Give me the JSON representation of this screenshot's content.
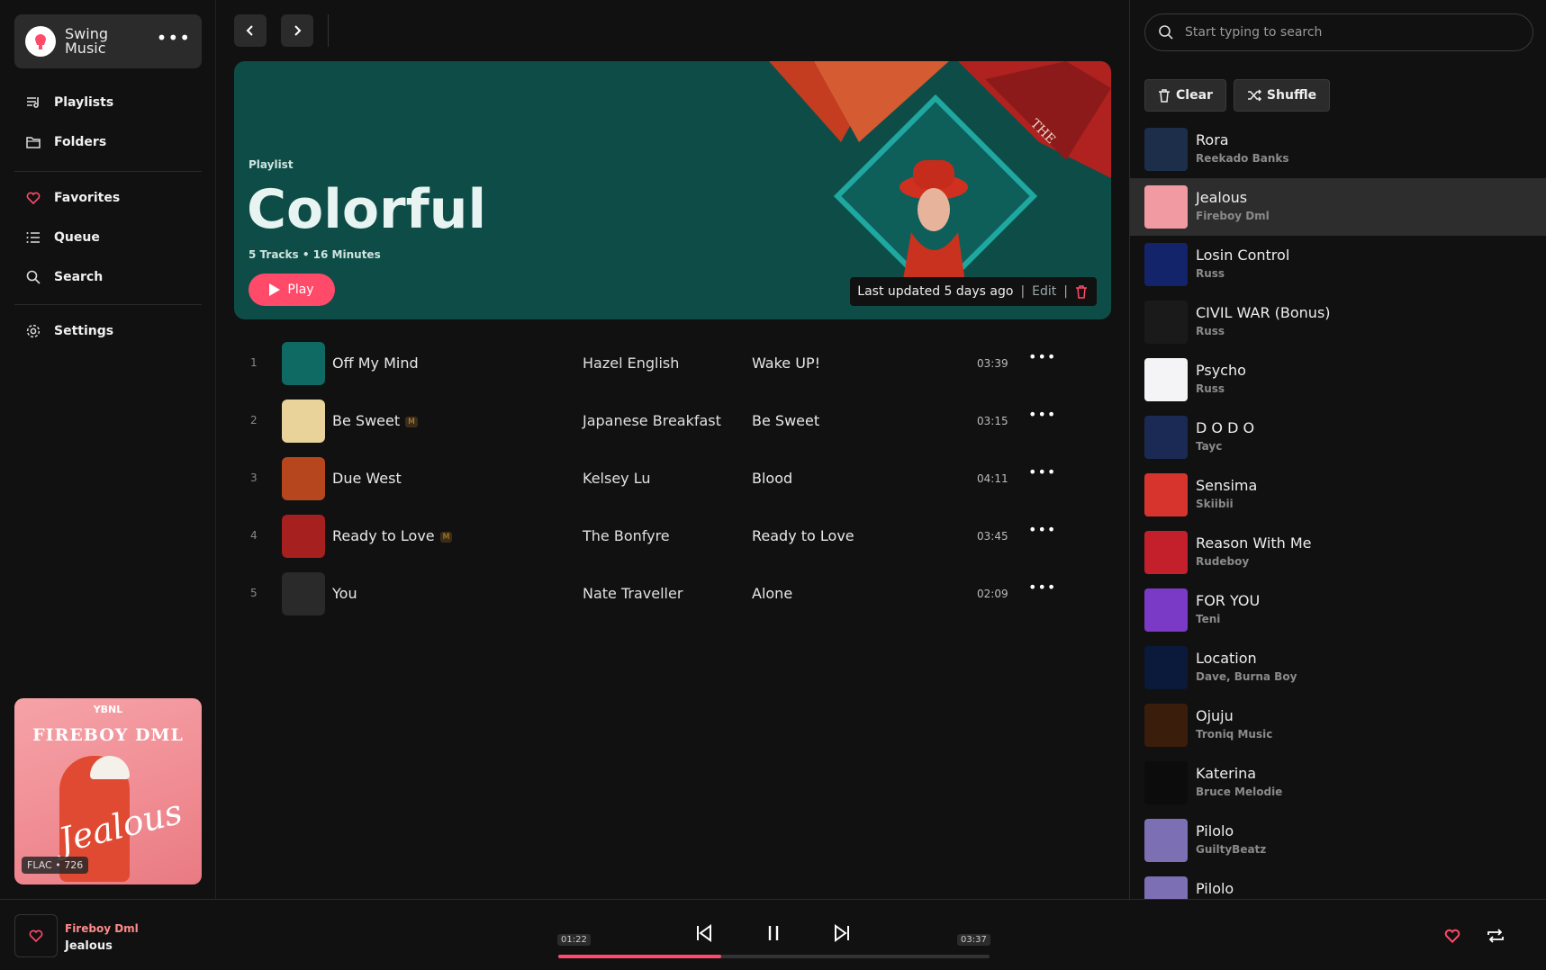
{
  "brand": {
    "name": "Swing Music"
  },
  "nav": {
    "playlists": "Playlists",
    "folders": "Folders",
    "favorites": "Favorites",
    "queue": "Queue",
    "search": "Search",
    "settings": "Settings"
  },
  "now_art": {
    "tag": "YBNL",
    "name": "FIREBOY DML",
    "script": "Jealous",
    "badge": "FLAC • 726"
  },
  "hero": {
    "label": "Playlist",
    "title": "Colorful",
    "meta": "5 Tracks • 16 Minutes",
    "play": "Play",
    "updated": "Last updated 5 days ago",
    "edit": "Edit"
  },
  "tracks": [
    {
      "num": "1",
      "title": "Off My Mind",
      "badge": "",
      "artist": "Hazel English",
      "album": "Wake UP!",
      "duration": "03:39",
      "color": "#0f6a63"
    },
    {
      "num": "2",
      "title": "Be Sweet",
      "badge": "M",
      "artist": "Japanese Breakfast",
      "album": "Be Sweet",
      "duration": "03:15",
      "color": "#e9d39a"
    },
    {
      "num": "3",
      "title": "Due West",
      "badge": "",
      "artist": "Kelsey Lu",
      "album": "Blood",
      "duration": "04:11",
      "color": "#b5461e"
    },
    {
      "num": "4",
      "title": "Ready to Love",
      "badge": "M",
      "artist": "The Bonfyre",
      "album": "Ready to Love",
      "duration": "03:45",
      "color": "#a6201f"
    },
    {
      "num": "5",
      "title": "You",
      "badge": "",
      "artist": "Nate Traveller",
      "album": "Alone",
      "duration": "02:09",
      "color": "#2a2a2a"
    }
  ],
  "search": {
    "placeholder": "Start typing to search"
  },
  "queue_buttons": {
    "clear": "Clear",
    "shuffle": "Shuffle"
  },
  "queue": [
    {
      "title": "Rora",
      "artist": "Reekado Banks",
      "color": "#1c2e4a"
    },
    {
      "title": "Jealous",
      "artist": "Fireboy Dml",
      "color": "#f29aa2"
    },
    {
      "title": "Losin Control",
      "artist": "Russ",
      "color": "#14246a"
    },
    {
      "title": "CIVIL WAR (Bonus)",
      "artist": "Russ",
      "color": "#1a1a1a"
    },
    {
      "title": "Psycho",
      "artist": "Russ",
      "color": "#f4f4f6"
    },
    {
      "title": "D O D O",
      "artist": "Tayc",
      "color": "#1b2a55"
    },
    {
      "title": "Sensima",
      "artist": "Skiibii",
      "color": "#d8342e"
    },
    {
      "title": "Reason With Me",
      "artist": "Rudeboy",
      "color": "#c4202b"
    },
    {
      "title": "FOR YOU",
      "artist": "Teni",
      "color": "#7a3ac6"
    },
    {
      "title": "Location",
      "artist": "Dave, Burna Boy",
      "color": "#0b1a3a"
    },
    {
      "title": "Ojuju",
      "artist": "Troniq Music",
      "color": "#3a1d0a"
    },
    {
      "title": "Katerina",
      "artist": "Bruce Melodie",
      "color": "#0c0c0c"
    },
    {
      "title": "Pilolo",
      "artist": "GuiltyBeatz",
      "color": "#7d6fb4"
    },
    {
      "title": "Pilolo",
      "artist": "",
      "color": "#7d6fb4"
    }
  ],
  "player": {
    "artist": "Fireboy Dml",
    "title": "Jealous",
    "elapsed": "01:22",
    "total": "03:37",
    "progress": 0.378
  },
  "colors": {
    "accent": "#ff4a6a",
    "hero_bg": "#0e4d47"
  },
  "icons": [
    "music-logo-icon",
    "more-icon",
    "playlists-icon",
    "folders-icon",
    "heart-icon",
    "queue-icon",
    "search-icon",
    "settings-icon",
    "chevron-left-icon",
    "chevron-right-icon",
    "play-icon",
    "trash-icon",
    "shuffle-icon",
    "previous-icon",
    "pause-icon",
    "next-icon",
    "repeat-icon"
  ]
}
